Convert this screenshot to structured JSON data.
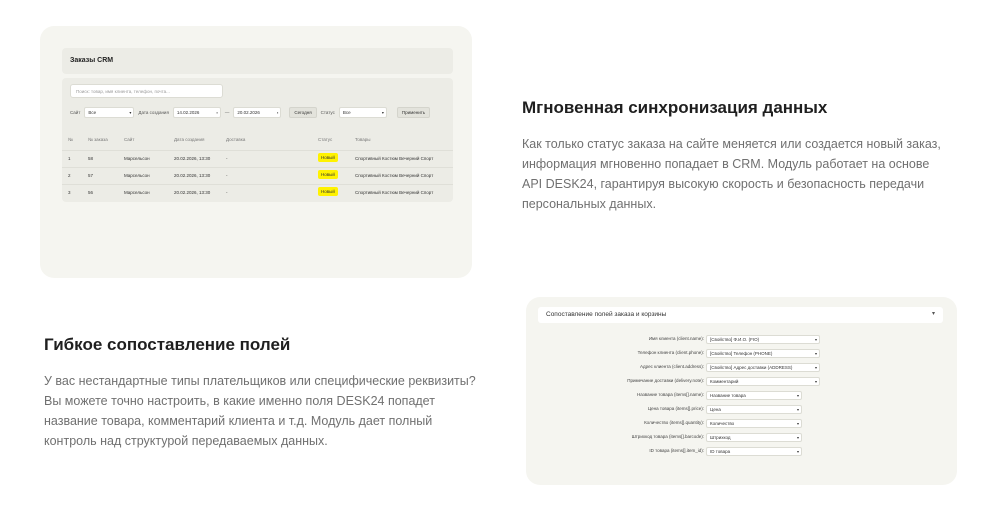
{
  "crm": {
    "title": "Заказы CRM",
    "search_placeholder": "Поиск: товар, имя клиента, телефон, почта...",
    "filters": {
      "site_label": "Сайт",
      "site_value": "Все",
      "date_label": "Дата создания",
      "date_from": "14.02.2026",
      "date_sep": "—",
      "date_to": "20.02.2026",
      "today_button": "Сегодня",
      "status_label": "Статус",
      "status_value": "Все",
      "apply_button": "Применить"
    },
    "columns": [
      "№",
      "№ заказа",
      "Сайт",
      "Дата создания",
      "Доставка",
      "Статус",
      "Товары"
    ],
    "rows": [
      {
        "num": "1",
        "order": "58",
        "site": "Марсельсон",
        "date": "20.02.2026, 13:30",
        "delivery": "-",
        "status": "Новый",
        "goods": "Спортивный Костюм Вечерний Спорт"
      },
      {
        "num": "2",
        "order": "57",
        "site": "Марсельсон",
        "date": "20.02.2026, 13:30",
        "delivery": "-",
        "status": "Новый",
        "goods": "Спортивный Костюм Вечерний Спорт"
      },
      {
        "num": "3",
        "order": "56",
        "site": "Марсельсон",
        "date": "20.02.2026, 13:30",
        "delivery": "-",
        "status": "Новый",
        "goods": "Спортивный Костюм Вечерний Спорт"
      }
    ]
  },
  "sync": {
    "title": "Мгновенная синхронизация данных",
    "text": "Как только статус заказа на сайте меняется или создается новый заказ, информация мгновенно попадает в CRM. Модуль работает на основе API DESK24, гарантируя высокую скорость и безопасность передачи персональных данных."
  },
  "mapping_text": {
    "title": "Гибкое сопоставление полей",
    "text": "У вас нестандартные типы плательщиков или специфические реквизиты? Вы можете точно настроить, в какие именно поля DESK24 попадет название товара, комментарий клиента и т.д. Модуль дает полный контроль над структурой передаваемых данных."
  },
  "mapping": {
    "title": "Сопоставление полей заказа и корзины",
    "rows": [
      {
        "label": "Имя клиента (client.name):",
        "value": "[Свойство] Ф.И.О. (FIO)"
      },
      {
        "label": "Телефон клиента (client.phone):",
        "value": "[Свойство] Телефон (PHONE)"
      },
      {
        "label": "Адрес клиента (client.address):",
        "value": "[Свойство] Адрес доставки (ADDRESS)"
      },
      {
        "label": "Примечание доставки (delivery.note):",
        "value": "Комментарий"
      },
      {
        "label": "Название товара (items[].name):",
        "value": "Название товара"
      },
      {
        "label": "Цена товара (items[].price):",
        "value": "Цена"
      },
      {
        "label": "Количество (items[].quantity):",
        "value": "Количество"
      },
      {
        "label": "Штрихкод товара (items[].barcode):",
        "value": "Штрихкод"
      },
      {
        "label": "ID товара (items[].item_id):",
        "value": "ID товара"
      }
    ]
  },
  "icons": {
    "chevron": "chevron-down-icon"
  }
}
